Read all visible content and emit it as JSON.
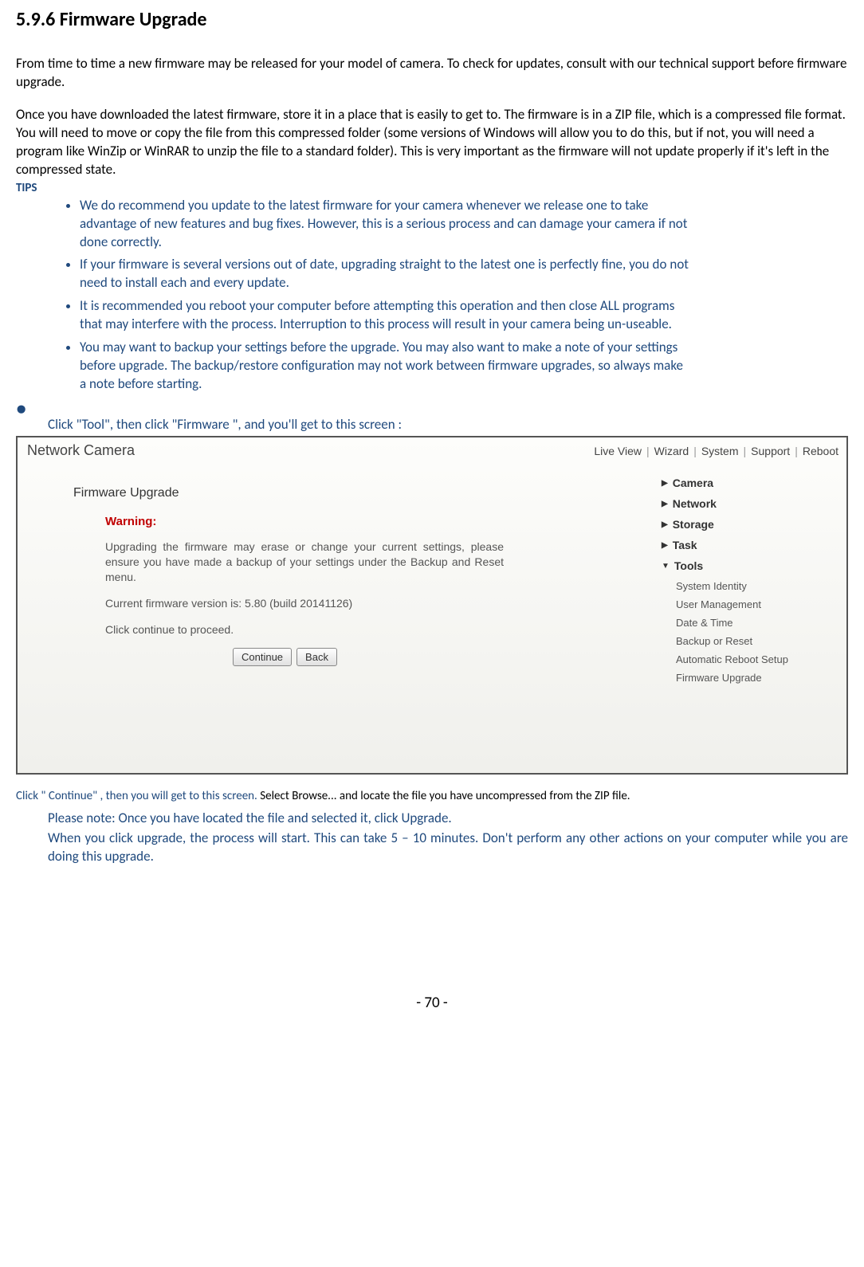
{
  "heading": "5.9.6 Firmware Upgrade",
  "para1": "From time to time a new firmware may be released for your model of camera. To check for updates, consult with our technical support before firmware upgrade.",
  "para2": "Once you have downloaded the latest firmware, store it in a place that is easily to get to. The firmware is in a ZIP file, which is a compressed file format. You will need to move or copy the file from this compressed folder (some versions of Windows will allow you to do this, but if not, you will need a program like WinZip or WinRAR to unzip the file to a standard folder). This is very important as the firmware will not update properly if it's left in the compressed state.",
  "tips_label": "TIPS",
  "tips": {
    "t1": "We do recommend you update to the latest firmware for your camera whenever we release one to take advantage of new features and bug fixes. However, this is a serious process and can damage your camera if not done correctly.",
    "t2": "If your firmware is several versions out of date, upgrading straight to the latest one is perfectly fine, you do not need to install each and every update.",
    "t3": "It is recommended you reboot your computer before attempting this operation and then close ALL programs that may interfere with the process. Interruption to this process will result in your camera being un-useable.",
    "t4": "You may want to backup your settings before the upgrade. You may also want to make a note of your settings before upgrade. The backup/restore configuration may not work between firmware upgrades, so always make a note before starting."
  },
  "click_line": "Click \"Tool\", then click \"Firmware \", and you'll get to this screen :",
  "screenshot": {
    "title": "Network Camera",
    "nav": {
      "live": "Live View",
      "wizard": "Wizard",
      "system": "System",
      "support": "Support",
      "reboot": "Reboot"
    },
    "main": {
      "heading": "Firmware Upgrade",
      "warning_label": "Warning:",
      "warning_text": "Upgrading the firmware may erase or change your current settings, please ensure you have made a backup of your settings under the Backup and Reset menu.",
      "version_text": "Current firmware version is: 5.80 (build 20141126)",
      "proceed_text": "Click continue to proceed.",
      "btn_continue": "Continue",
      "btn_back": "Back"
    },
    "sidebar": {
      "camera": "Camera",
      "network": "Network",
      "storage": "Storage",
      "task": "Task",
      "tools": "Tools",
      "sub": {
        "identity": "System Identity",
        "user": "User Management",
        "date": "Date & Time",
        "backup": "Backup or Reset",
        "reboot": "Automatic Reboot Setup",
        "firmware": "Firmware Upgrade"
      }
    }
  },
  "after": {
    "line1a": "Click \" Continue\" , then you will get to this screen. ",
    "line1b": "Select Browse... and locate the file you have uncompressed from the ZIP file.",
    "note1": "Please note: Once you have located the file and selected it, click Upgrade.",
    "note2": "When you click upgrade, the process will start. This can take 5 – 10 minutes. Don't perform any other actions on your computer while you are doing this upgrade."
  },
  "page_num": "- 70 -"
}
